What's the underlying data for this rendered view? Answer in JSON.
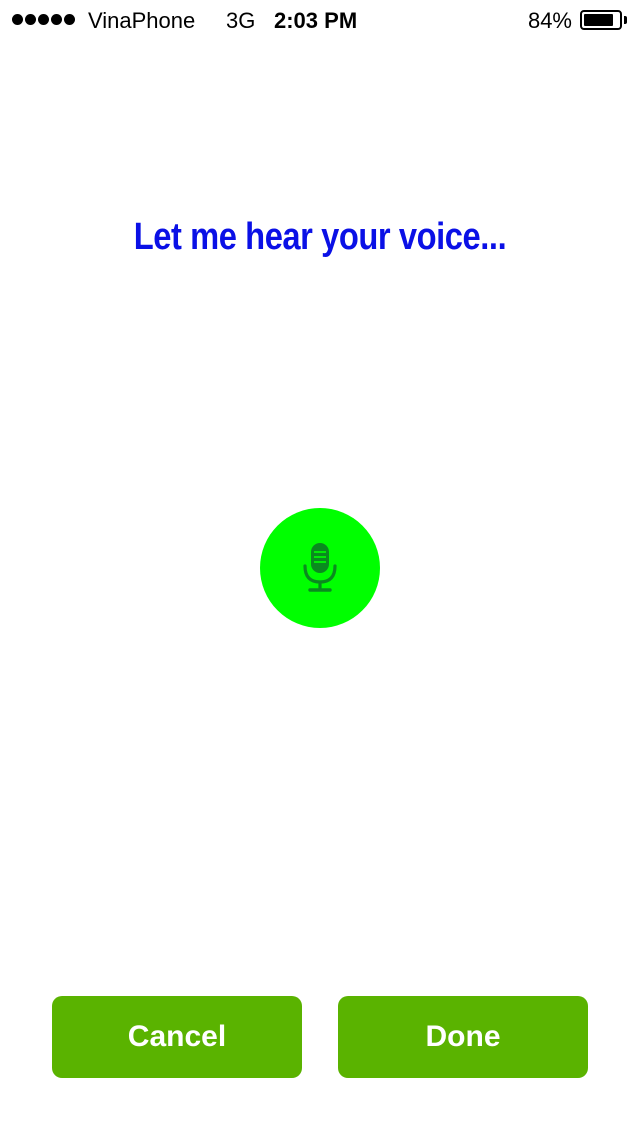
{
  "status_bar": {
    "carrier": "VinaPhone",
    "network": "3G",
    "time": "2:03 PM",
    "battery_percent": "84%",
    "battery_level": 0.84,
    "signal_bars": 5
  },
  "prompt": {
    "text": "Let me hear your voice..."
  },
  "mic": {
    "icon": "microphone-icon",
    "button_color": "#00ff00",
    "icon_color": "#0a8a1f"
  },
  "actions": {
    "cancel_label": "Cancel",
    "done_label": "Done",
    "button_color": "#5ab300"
  },
  "colors": {
    "prompt_text": "#0a10e6",
    "background": "#ffffff"
  }
}
